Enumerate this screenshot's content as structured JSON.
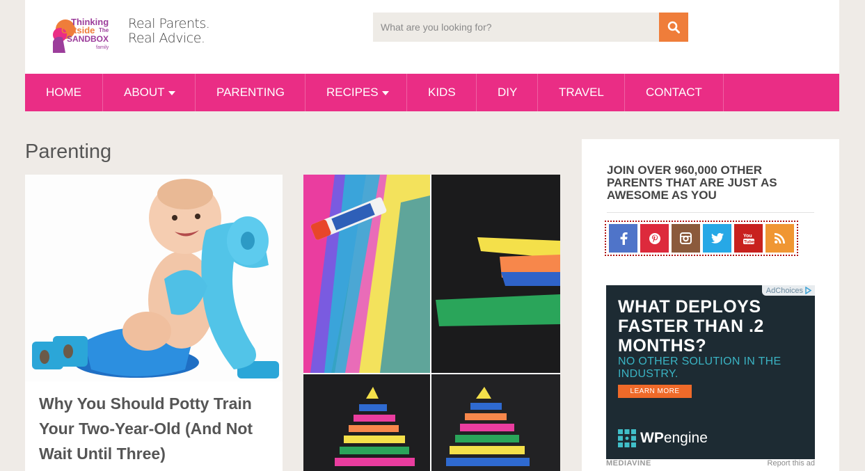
{
  "header": {
    "logo_text": "Thinking Outside The Sandbox family",
    "tagline_line1": "Real Parents.",
    "tagline_line2": "Real Advice.",
    "search_placeholder": "What are you looking for?",
    "search_icon": "search-icon"
  },
  "nav": {
    "items": [
      {
        "label": "HOME",
        "has_dropdown": false
      },
      {
        "label": "ABOUT",
        "has_dropdown": true
      },
      {
        "label": "PARENTING",
        "has_dropdown": false
      },
      {
        "label": "RECIPES",
        "has_dropdown": true
      },
      {
        "label": "KIDS",
        "has_dropdown": false
      },
      {
        "label": "DIY",
        "has_dropdown": false
      },
      {
        "label": "TRAVEL",
        "has_dropdown": false
      },
      {
        "label": "CONTACT",
        "has_dropdown": false
      }
    ]
  },
  "main": {
    "page_title": "Parenting",
    "posts": [
      {
        "title": "Why You Should Potty Train Your Two-Year-Old (And Not Wait Until Three)"
      },
      {
        "title": ""
      }
    ]
  },
  "sidebar": {
    "join_heading": "JOIN OVER 960,000 OTHER PARENTS THAT ARE JUST AS AWESOME AS YOU",
    "social": [
      {
        "name": "facebook-icon",
        "color": "#4f74c9"
      },
      {
        "name": "pinterest-icon",
        "color": "#dd2a3c"
      },
      {
        "name": "instagram-icon",
        "color": "#8b5a3c"
      },
      {
        "name": "twitter-icon",
        "color": "#27a8e6"
      },
      {
        "name": "youtube-icon",
        "color": "#c8211e"
      },
      {
        "name": "rss-icon",
        "color": "#f09633"
      }
    ],
    "ad": {
      "adchoices": "AdChoices",
      "headline": "WHAT DEPLOYS FASTER THAN .2 MONTHS?",
      "subhead": "NO OTHER SOLUTION IN THE INDUSTRY.",
      "button": "LEARN MORE",
      "brand_bold": "WP",
      "brand_light": "engine",
      "network": "MEDIAVINE",
      "report": "Report this ad"
    }
  },
  "colors": {
    "nav_bg": "#ea2d85",
    "search_button": "#ef7d3a",
    "page_bg": "#efebe7",
    "ad_bg": "#1d2b33"
  }
}
